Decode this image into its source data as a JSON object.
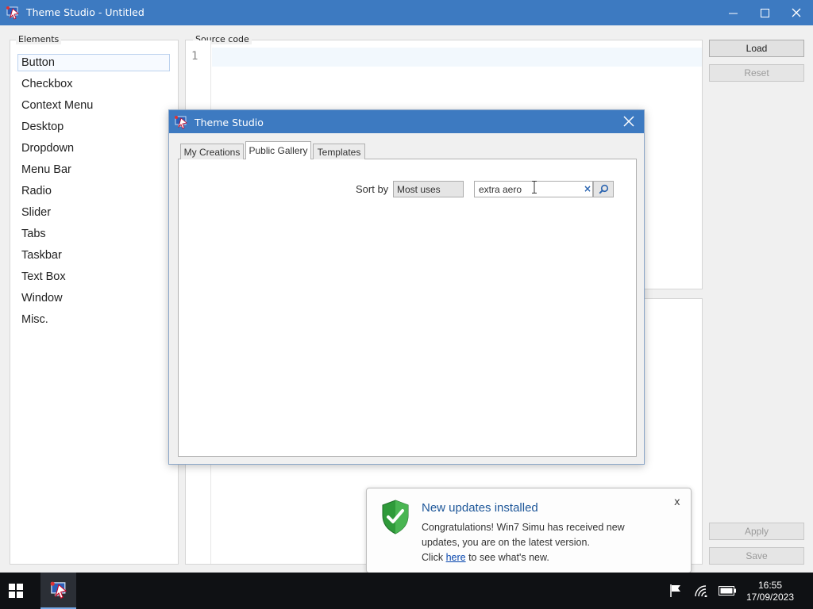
{
  "main_window": {
    "title": "Theme Studio - Untitled",
    "controls": {
      "minimize": "—",
      "maximize": "☐",
      "close": "✕"
    }
  },
  "elements_panel": {
    "label": "Elements",
    "items": [
      "Button",
      "Checkbox",
      "Context Menu",
      "Desktop",
      "Dropdown",
      "Menu Bar",
      "Radio",
      "Slider",
      "Tabs",
      "Taskbar",
      "Text Box",
      "Window",
      "Misc."
    ],
    "selected": "Button"
  },
  "source_panel": {
    "label": "Source code",
    "line_number": "1"
  },
  "side_buttons": {
    "load": "Load",
    "reset": "Reset",
    "apply": "Apply",
    "save": "Save"
  },
  "dialog": {
    "title": "Theme Studio",
    "close": "✕",
    "tabs": [
      "My Creations",
      "Public Gallery",
      "Templates"
    ],
    "active_tab": "Public Gallery",
    "sort_label": "Sort by",
    "sort_value": "Most uses",
    "search_value": "extra aero",
    "search_clear": "×"
  },
  "notification": {
    "title": "New updates installed",
    "line1": "Congratulations! Win7 Simu has received new",
    "line2": "updates, you are on the latest version.",
    "line3_prefix": "Click ",
    "link": "here",
    "line3_suffix": " to see what's new.",
    "close": "x"
  },
  "taskbar": {
    "time": "16:55",
    "date": "17/09/2023"
  },
  "colors": {
    "titlebar": "#3d7ac1",
    "taskbar": "#0f1114",
    "notif_title": "#1e5799"
  }
}
